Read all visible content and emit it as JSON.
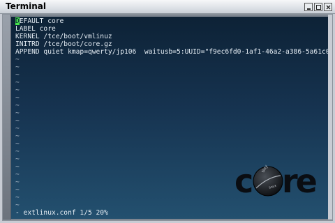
{
  "window": {
    "title": "Terminal",
    "buttons": [
      "minimize",
      "maximize",
      "close"
    ]
  },
  "editor": {
    "lines": [
      "DEFAULT core",
      "LABEL core",
      "KERNEL /tce/boot/vmlinuz",
      "INITRD /tce/boot/core.gz",
      "APPEND quiet kmap=qwerty/jp106  waitusb=5:UUID=\"f9ec6fd0-1af1-46a2-a386-5a61c0b1"
    ],
    "cursor_char": "D",
    "first_line_rest": "EFAULT core",
    "tilde_count": 20,
    "status_line": "- extlinux.conf 1/5 20%"
  },
  "logo": {
    "small_text": "tiny",
    "big_text": "core",
    "sub_text": "linux"
  },
  "colors": {
    "cursor": "#44e64a",
    "terminal_bg_top": "#0d2236",
    "terminal_bg_bottom": "#23506f"
  }
}
